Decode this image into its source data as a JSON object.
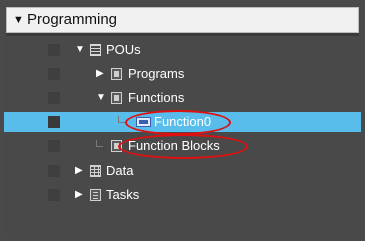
{
  "panel": {
    "title": "Programming"
  },
  "tree": [
    {
      "label": "POUs",
      "icon": "pou-document-icon",
      "expanded": true
    },
    {
      "label": "Programs",
      "icon": "programs-folder-icon",
      "expanded": false
    },
    {
      "label": "Functions",
      "icon": "functions-folder-icon",
      "expanded": true
    },
    {
      "label": "Function0",
      "icon": "function-icon",
      "selected": true
    },
    {
      "label": "Function Blocks",
      "icon": "function-blocks-folder-icon"
    },
    {
      "label": "Data",
      "icon": "data-table-icon",
      "expanded": false
    },
    {
      "label": "Tasks",
      "icon": "tasks-icon",
      "expanded": false
    }
  ],
  "colors": {
    "selection": "#58bdeb",
    "highlight_oval": "#e01010",
    "panel_bg": "#494949"
  }
}
